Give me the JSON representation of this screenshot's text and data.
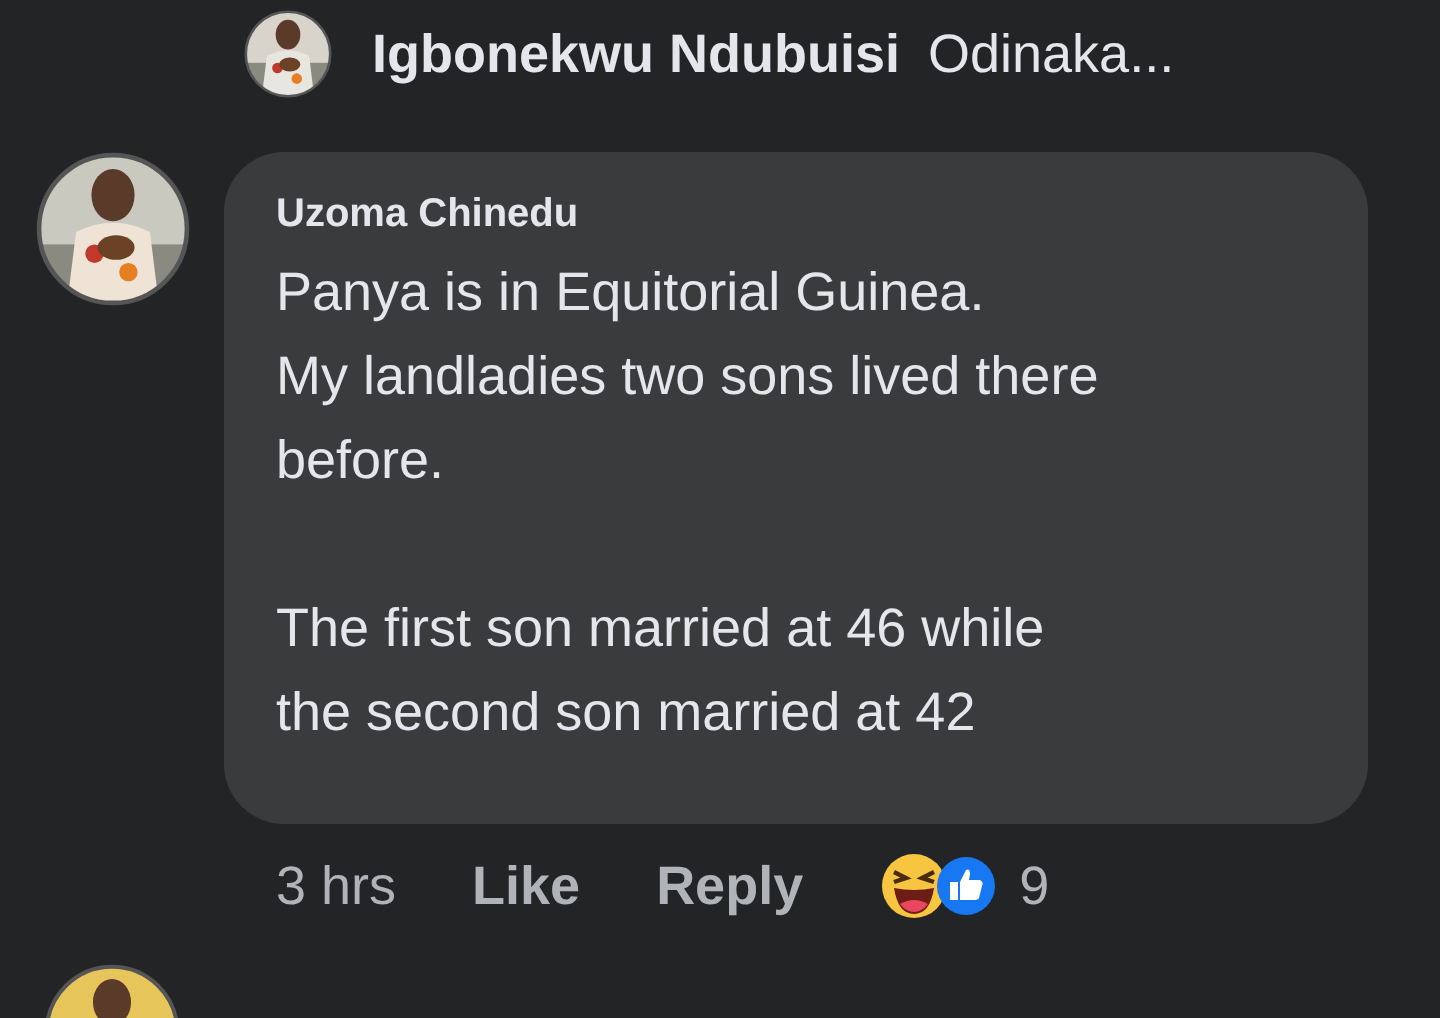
{
  "reply_header": {
    "author": "Igbonekwu Ndubuisi",
    "preview": "Odinaka..."
  },
  "comment": {
    "author": "Uzoma Chinedu",
    "paragraphs": [
      [
        "Panya is in Equitorial Guinea.",
        "My landladies two sons lived there",
        "before."
      ],
      [
        "The first son married at 46 while",
        "the second son married at 42"
      ]
    ],
    "time": "3 hrs",
    "actions": [
      "Like",
      "Reply"
    ],
    "reaction_count": "9"
  }
}
